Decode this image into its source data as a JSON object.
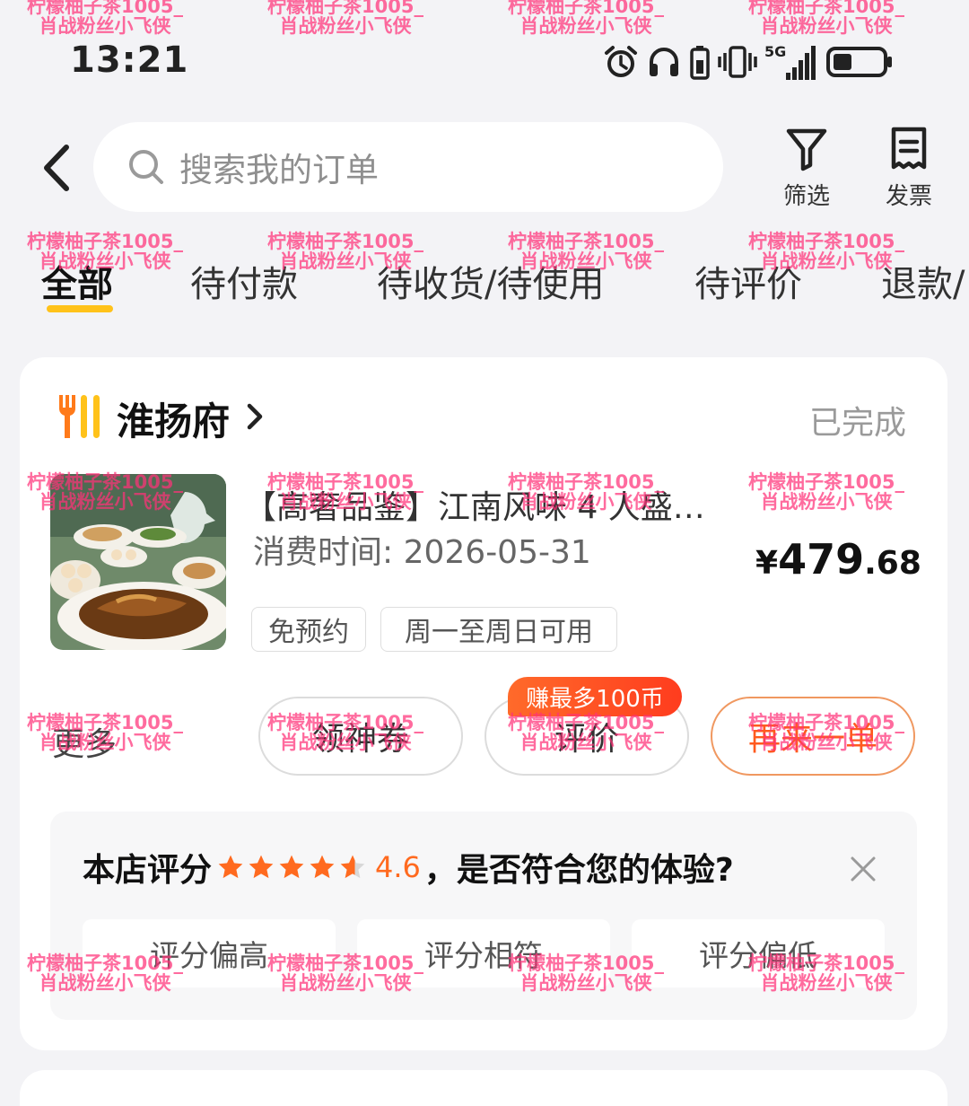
{
  "status_bar": {
    "time": "13:21",
    "icons": [
      "alarm-icon",
      "headphones-icon",
      "battery-saver-icon",
      "vibrate-icon",
      "signal-5g-icon",
      "battery-icon"
    ],
    "network_label": "5G"
  },
  "header": {
    "search_placeholder": "搜索我的订单",
    "actions": [
      {
        "label": "筛选",
        "icon": "filter-icon"
      },
      {
        "label": "发票",
        "icon": "invoice-icon"
      }
    ]
  },
  "tabs": [
    {
      "label": "全部",
      "active": true
    },
    {
      "label": "待付款",
      "active": false
    },
    {
      "label": "待收货/待使用",
      "active": false
    },
    {
      "label": "待评价",
      "active": false
    },
    {
      "label": "退款/",
      "active": false
    }
  ],
  "colors": {
    "accent_yellow": "#ffc21a",
    "accent_orange": "#ff5a1f",
    "star_orange": "#ff6a1f"
  },
  "order": {
    "shop_name": "淮扬府",
    "shop_icon": "fork-knife-icon",
    "status": "已完成",
    "product_title": "【高奢品鉴】江南风味 4 人盛…",
    "consume_time": "消费时间: 2026-05-31",
    "price_currency": "¥",
    "price_integer": "479",
    "price_decimal": ".68",
    "tags": [
      "免预约",
      "周一至周日可用"
    ],
    "more_label": "更多",
    "actions": [
      {
        "label": "领神券"
      },
      {
        "label": "评价",
        "badge": "赚最多100币"
      },
      {
        "label": "再来一单",
        "primary": true
      }
    ]
  },
  "rating": {
    "prefix": "本店评分",
    "score": "4.6",
    "stars_value": 4.6,
    "stars_total": 5,
    "question": "，是否符合您的体验?",
    "options": [
      "评分偏高",
      "评分相符",
      "评分偏低"
    ]
  },
  "watermark": {
    "line1": "柠檬柚子茶1005_",
    "line2": "肖战粉丝小飞侠"
  }
}
